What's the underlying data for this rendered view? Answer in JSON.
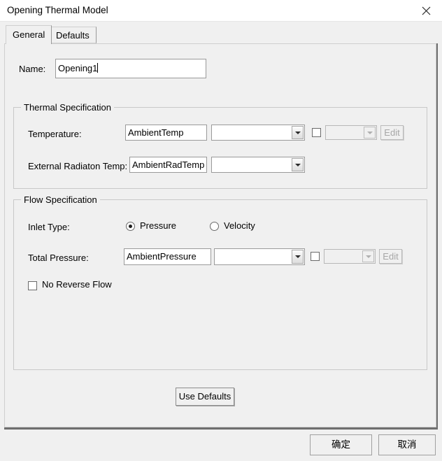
{
  "window": {
    "title": "Opening Thermal Model",
    "close_icon": "close-icon"
  },
  "tabs": [
    {
      "label": "General",
      "selected": true
    },
    {
      "label": "Defaults",
      "selected": false
    }
  ],
  "general": {
    "name_label": "Name:",
    "name_value": "Opening1",
    "thermal_specification": {
      "title": "Thermal Specification",
      "temperature": {
        "label": "Temperature:",
        "value": "AmbientTemp",
        "unit_combo_value": "",
        "checkbox_checked": false,
        "extra_combo_value": "",
        "extra_combo_disabled": true,
        "edit_button": "Edit",
        "edit_button_disabled": true
      },
      "external_radiation_temp": {
        "label": "External Radiaton Temp:",
        "value": "AmbientRadTemp",
        "unit_combo_value": ""
      }
    },
    "flow_specification": {
      "title": "Flow Specification",
      "inlet_type": {
        "label": "Inlet Type:",
        "options": [
          "Pressure",
          "Velocity"
        ],
        "selected": "Pressure"
      },
      "total_pressure": {
        "label": "Total Pressure:",
        "value": "AmbientPressure",
        "unit_combo_value": "",
        "checkbox_checked": false,
        "extra_combo_value": "",
        "extra_combo_disabled": true,
        "edit_button": "Edit",
        "edit_button_disabled": true
      },
      "no_reverse_flow": {
        "label": "No Reverse Flow",
        "checked": false
      }
    },
    "use_defaults_button": "Use Defaults"
  },
  "footer": {
    "ok_button": "确定",
    "cancel_button": "取消"
  },
  "colors": {
    "window_background": "#f0f0f0",
    "titlebar_background": "#ffffff",
    "field_background": "#ffffff",
    "border": "#9a9a9a",
    "disabled_text": "#a6a6a6"
  }
}
